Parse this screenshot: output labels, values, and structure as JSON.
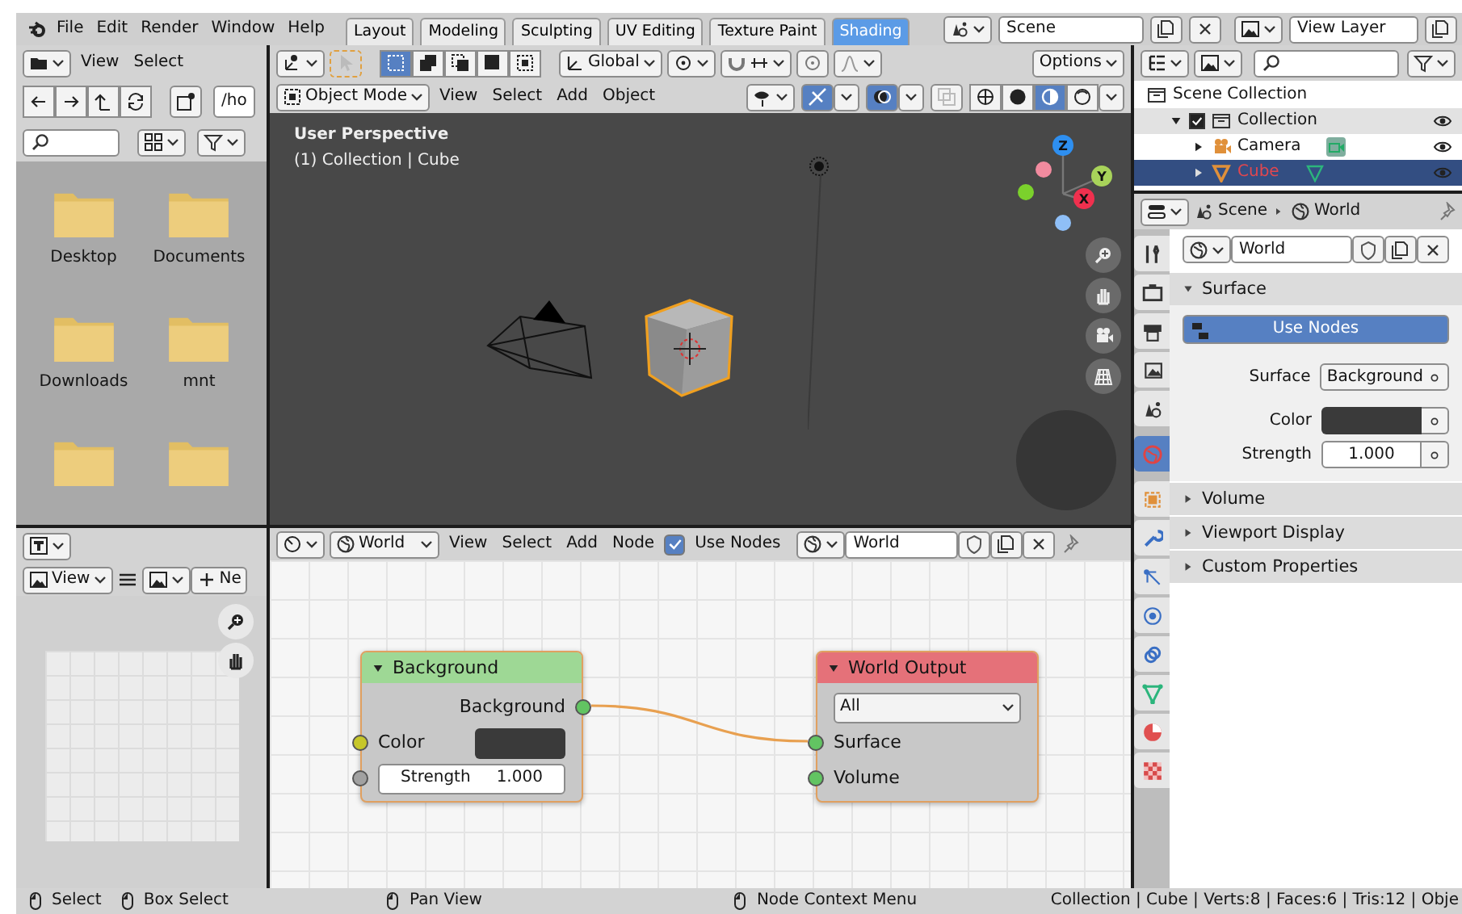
{
  "top_bar": {
    "menus": [
      "File",
      "Edit",
      "Render",
      "Window",
      "Help"
    ],
    "workspaces": [
      {
        "label": "Layout",
        "selected": false
      },
      {
        "label": "Modeling",
        "selected": false
      },
      {
        "label": "Sculpting",
        "selected": false
      },
      {
        "label": "UV Editing",
        "selected": false
      },
      {
        "label": "Texture Paint",
        "selected": false
      },
      {
        "label": "Shading",
        "selected": true
      }
    ],
    "scene": "Scene",
    "view_layer": "View Layer"
  },
  "file_browser": {
    "menus": [
      "View",
      "Select"
    ],
    "path": "/ho",
    "folders": [
      "Desktop",
      "Documents",
      "Downloads",
      "mnt"
    ]
  },
  "viewport": {
    "transform_orientation": "Global",
    "options": "Options",
    "mode": "Object Mode",
    "menus": [
      "View",
      "Select",
      "Add",
      "Object"
    ],
    "select_modes": [
      {
        "selected": true
      },
      {
        "selected": false
      },
      {
        "selected": false
      },
      {
        "selected": false
      },
      {
        "selected": false
      }
    ],
    "shading_modes": [
      {
        "kind": "wireframe",
        "selected": false
      },
      {
        "kind": "solid",
        "selected": false
      },
      {
        "kind": "material",
        "selected": true
      },
      {
        "kind": "rendered",
        "selected": false
      }
    ],
    "overlay_text": [
      "User Perspective",
      "(1) Collection | Cube"
    ],
    "axes": [
      "Z",
      "Y",
      "X"
    ]
  },
  "outliner": {
    "tree": [
      {
        "label": "Scene Collection",
        "children": [
          {
            "label": "Collection",
            "checked": true,
            "expanded": true,
            "children": [
              {
                "label": "Camera",
                "kind": "camera",
                "selected": false
              },
              {
                "label": "Cube",
                "kind": "mesh",
                "selected": true
              }
            ]
          }
        ]
      }
    ]
  },
  "properties": {
    "breadcrumb": [
      "Scene",
      "World"
    ],
    "datablock": "World",
    "tabs": [
      {
        "kind": "tool",
        "selected": false
      },
      {
        "kind": "render",
        "selected": false
      },
      {
        "kind": "output",
        "selected": false
      },
      {
        "kind": "view_layer",
        "selected": false
      },
      {
        "kind": "scene",
        "selected": false
      },
      {
        "kind": "world",
        "selected": true
      },
      {
        "kind": "object",
        "selected": false
      },
      {
        "kind": "modifier",
        "selected": false
      },
      {
        "kind": "particles",
        "selected": false
      },
      {
        "kind": "physics",
        "selected": false
      },
      {
        "kind": "constraints",
        "selected": false
      },
      {
        "kind": "data",
        "selected": false
      },
      {
        "kind": "material",
        "selected": false
      },
      {
        "kind": "texture",
        "selected": false
      }
    ],
    "panels": [
      {
        "title": "Surface",
        "expanded": true,
        "use_nodes": "Use Nodes",
        "fields": [
          {
            "label": "Surface",
            "kind": "button",
            "value": "Background"
          },
          {
            "label": "Color",
            "kind": "color",
            "color": "#3a3a3a"
          },
          {
            "label": "Strength",
            "kind": "number",
            "value": "1.000"
          }
        ]
      },
      {
        "title": "Volume",
        "expanded": false
      },
      {
        "title": "Viewport Display",
        "expanded": false
      },
      {
        "title": "Custom Properties",
        "expanded": false
      }
    ]
  },
  "image_editor": {
    "view_menu": "View",
    "new_button": "Ne"
  },
  "node_editor": {
    "datablock_type": "World",
    "menus": [
      "View",
      "Select",
      "Add",
      "Node"
    ],
    "use_nodes": {
      "label": "Use Nodes",
      "checked": true
    },
    "datablock": "World",
    "nodes": [
      {
        "title": "Background",
        "color": "#9ed895",
        "outputs": [
          {
            "kind": "shader",
            "label": "Background",
            "linked": true
          }
        ],
        "inputs": [
          {
            "kind": "color",
            "label": "Color",
            "color": "#3a3a3a"
          },
          {
            "kind": "value",
            "label": "Strength",
            "value": "1.000"
          }
        ]
      },
      {
        "title": "World Output",
        "color": "#e57179",
        "target": "All",
        "inputs": [
          {
            "kind": "shader",
            "label": "Surface",
            "linked": true
          },
          {
            "kind": "shader",
            "label": "Volume"
          }
        ]
      }
    ]
  },
  "status_bar": {
    "hints": [
      "Select",
      "Box Select",
      "Pan View",
      "Node Context Menu"
    ],
    "stats": "Collection | Cube | Verts:8 | Faces:6 | Tris:12 | Obje"
  }
}
